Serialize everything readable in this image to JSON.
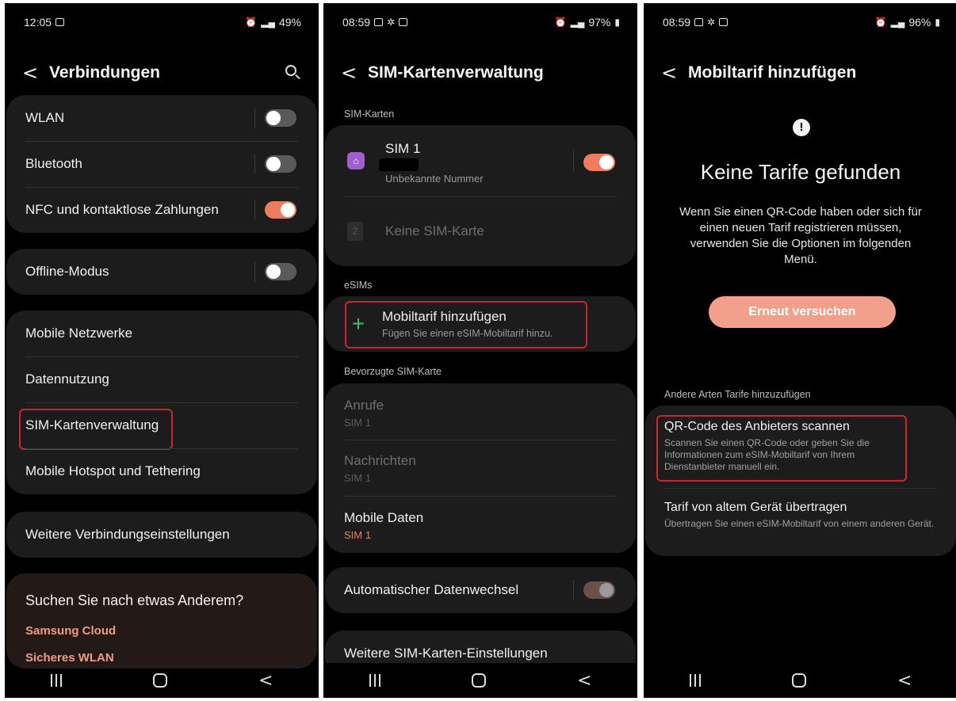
{
  "screen1": {
    "status": {
      "time": "12:05",
      "right": "49%"
    },
    "title": "Verbindungen",
    "group1": [
      {
        "label": "WLAN",
        "on": false
      },
      {
        "label": "Bluetooth",
        "on": false
      },
      {
        "label": "NFC und kontaktlose Zahlungen",
        "on": true
      }
    ],
    "offline": {
      "label": "Offline-Modus",
      "on": false
    },
    "group3": [
      "Mobile Netzwerke",
      "Datennutzung",
      "SIM-Kartenverwaltung",
      "Mobile Hotspot und Tethering"
    ],
    "more": "Weitere Verbindungseinstellungen",
    "suggest": {
      "title": "Suchen Sie nach etwas Anderem?",
      "links": [
        "Samsung Cloud",
        "Sicheres WLAN"
      ]
    }
  },
  "screen2": {
    "status": {
      "time": "08:59",
      "right": "97%"
    },
    "title": "SIM-Kartenverwaltung",
    "sim_section": "SIM-Karten",
    "sim1": {
      "name": "SIM 1",
      "number": "Unbekannte Nummer",
      "on": true
    },
    "sim2": {
      "name": "Keine SIM-Karte",
      "slot": "2"
    },
    "esim_section": "eSIMs",
    "add": {
      "title": "Mobiltarif hinzufügen",
      "sub": "Fügen Sie einen eSIM-Mobiltarif hinzu."
    },
    "pref_section": "Bevorzugte SIM-Karte",
    "pref": [
      {
        "label": "Anrufe",
        "value": "SIM 1"
      },
      {
        "label": "Nachrichten",
        "value": "SIM 1"
      },
      {
        "label": "Mobile Daten",
        "value": "SIM 1"
      }
    ],
    "auto_switch": "Automatischer Datenwechsel",
    "more": "Weitere SIM-Karten-Einstellungen"
  },
  "screen3": {
    "status": {
      "time": "08:59",
      "right": "96%"
    },
    "title": "Mobiltarif hinzufügen",
    "alert_icon": "!",
    "heading": "Keine Tarife gefunden",
    "message": "Wenn Sie einen QR-Code haben oder sich für einen neuen Tarif registrieren müssen, verwenden Sie die Optionen im folgenden Menü.",
    "retry": "Erneut versuchen",
    "other_section": "Andere Arten Tarife hinzuzufügen",
    "qr": {
      "title": "QR-Code des Anbieters scannen",
      "sub": "Scannen Sie einen QR-Code oder geben Sie die Informationen zum eSIM-Mobiltarif von Ihrem Dienstanbieter manuell ein."
    },
    "transfer": {
      "title": "Tarif von altem Gerät übertragen",
      "sub": "Übertragen Sie einen eSIM-Mobiltarif von einem anderen Gerät."
    }
  },
  "colors": {
    "accent": "#ee7c5f",
    "highlight": "#d6202d",
    "card": "#1c1c1c"
  }
}
